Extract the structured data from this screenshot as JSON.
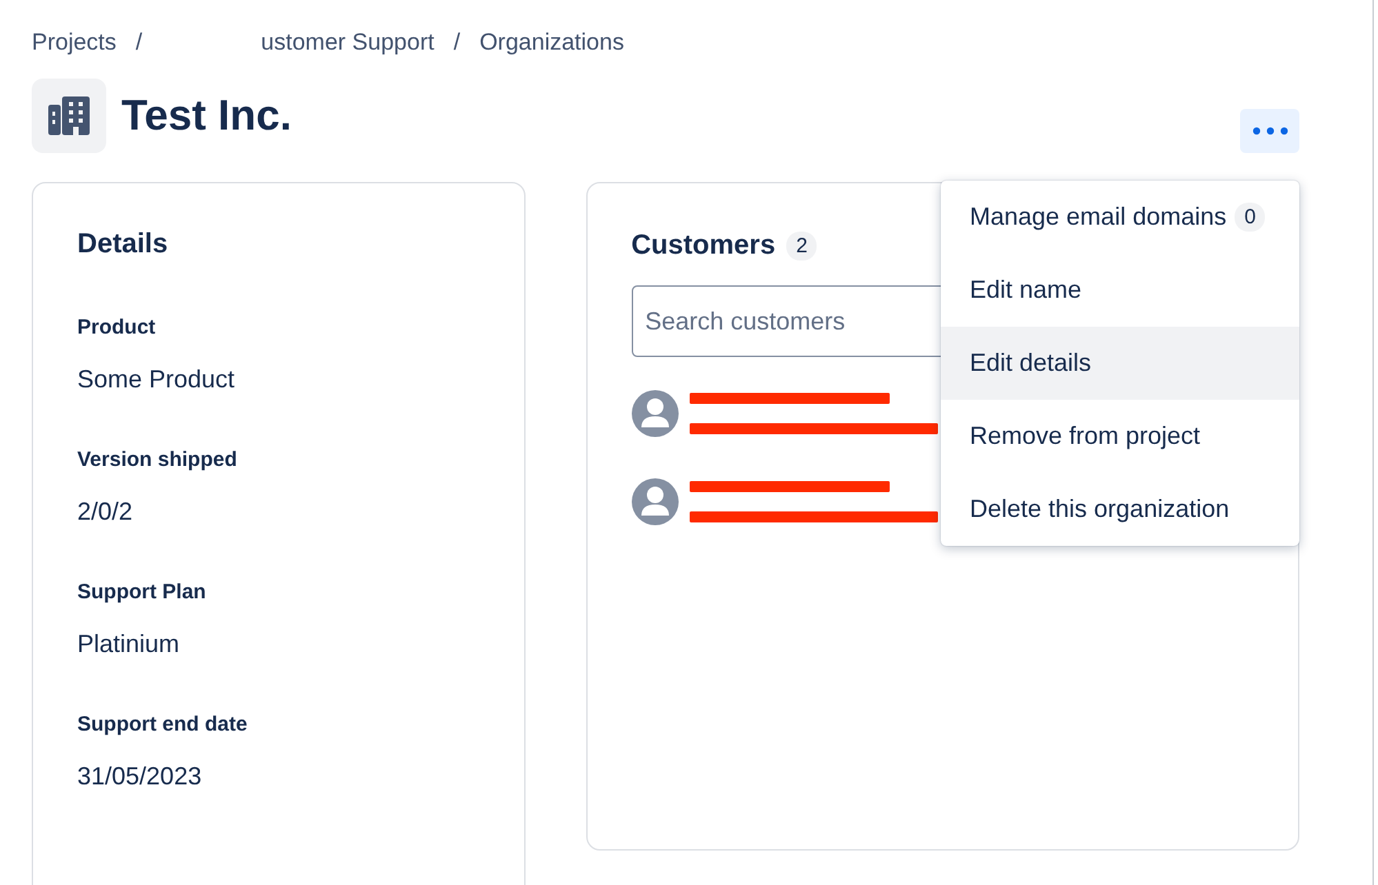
{
  "breadcrumbs": [
    {
      "kind": "link",
      "text": "Projects"
    },
    {
      "kind": "separator",
      "text": "/"
    },
    {
      "kind": "link",
      "text": "ustomer Support"
    },
    {
      "kind": "separator",
      "text": "/"
    },
    {
      "kind": "link",
      "text": "Organizations"
    }
  ],
  "title": "Test Inc.",
  "details": {
    "title": "Details",
    "fields": [
      {
        "label": "Product",
        "value": "Some Product"
      },
      {
        "label": "Version shipped",
        "value": "2/0/2"
      },
      {
        "label": "Support Plan",
        "value": "Platinium"
      },
      {
        "label": "Support end date",
        "value": "31/05/2023"
      }
    ]
  },
  "customers": {
    "title": "Customers",
    "count": "2",
    "search": {
      "placeholder": "Search customers"
    },
    "items": [
      {
        "kind": "redacted"
      },
      {
        "kind": "redacted"
      }
    ]
  },
  "menu": {
    "items": [
      {
        "label": "Manage email domains",
        "badge": "0",
        "highlighted": false
      },
      {
        "label": "Edit name",
        "highlighted": false
      },
      {
        "label": "Edit details",
        "highlighted": true
      },
      {
        "label": "Remove from project",
        "highlighted": false
      },
      {
        "label": "Delete this organization",
        "highlighted": false
      }
    ]
  }
}
